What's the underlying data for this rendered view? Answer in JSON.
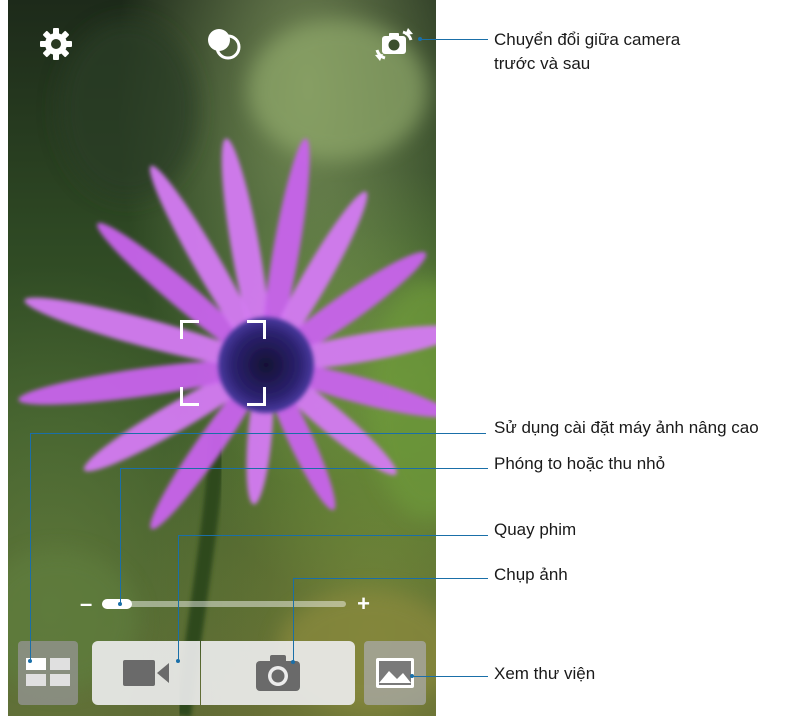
{
  "callouts": {
    "switch_camera": [
      "Chuyển đổi giữa camera",
      "trước và sau"
    ],
    "advanced_settings": "Sử dụng cài đặt máy ảnh nâng cao",
    "zoom": "Phóng to hoặc thu nhỏ",
    "record_video": "Quay phim",
    "take_photo": "Chụp ảnh",
    "view_gallery": "Xem thư viện"
  },
  "zoom": {
    "minus": "–",
    "plus": "+",
    "level_fraction": 0.0
  },
  "icons": {
    "settings": "gear-icon",
    "effects": "effects-icon",
    "switch_camera": "camera-switch-icon",
    "mode": "grid-mode-icon",
    "video": "video-camera-icon",
    "photo": "camera-icon",
    "gallery": "gallery-icon"
  },
  "colors": {
    "callout_line": "#1a6fa8",
    "flower_petal": "#c35ae8",
    "flower_center": "#2c1f6b"
  }
}
